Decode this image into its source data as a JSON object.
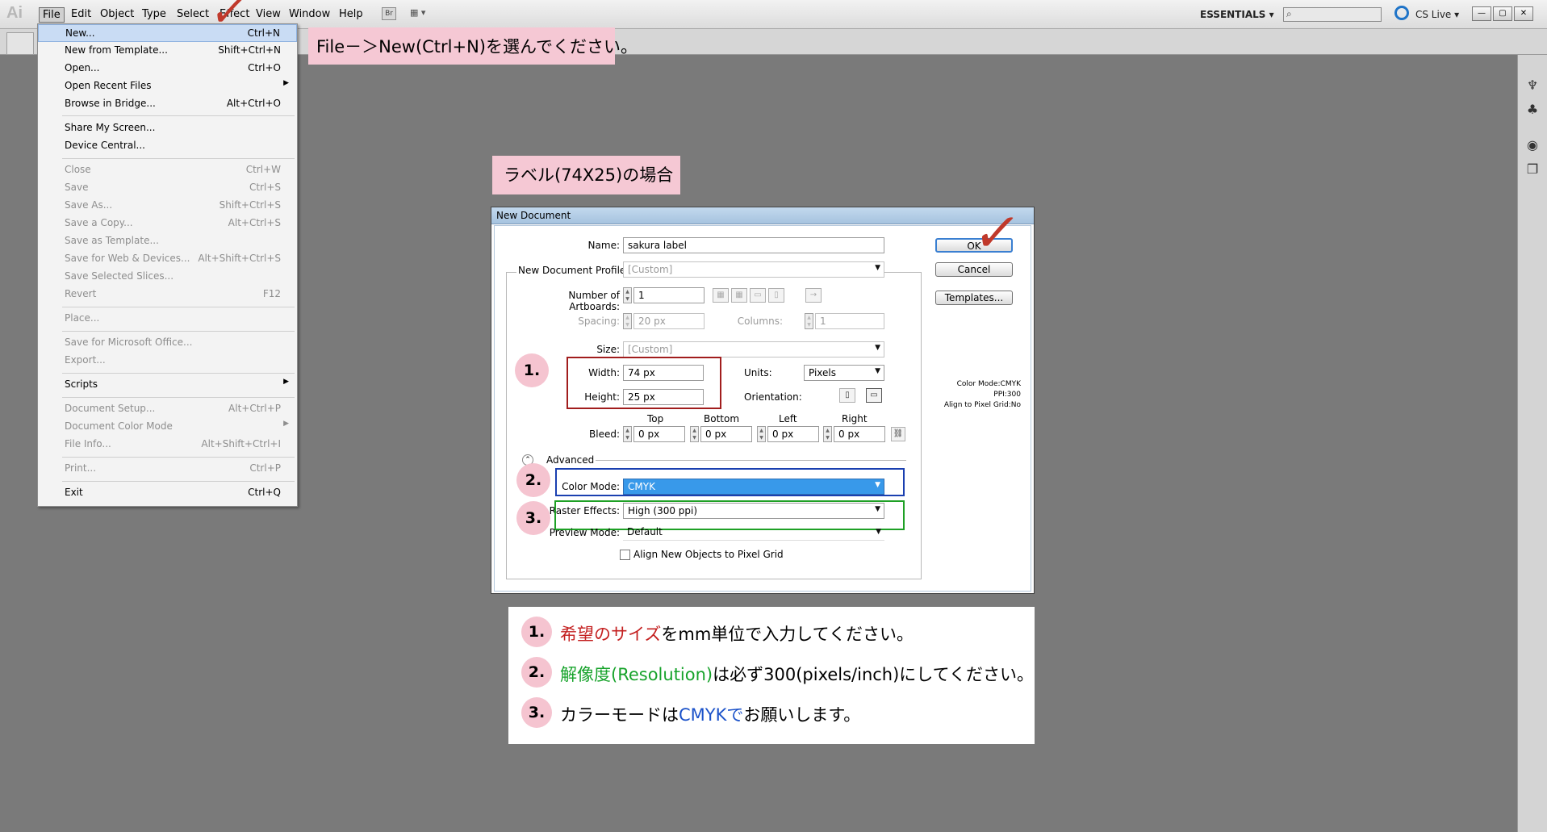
{
  "menubar": {
    "app_logo": "Ai",
    "menus": [
      "File",
      "Edit",
      "Object",
      "Type",
      "Select",
      "Effect",
      "View",
      "Window",
      "Help"
    ],
    "bridge_label": "Br",
    "workspace": "ESSENTIALS",
    "cs_live": "CS Live",
    "window_buttons": [
      "—",
      "▢",
      "✕"
    ]
  },
  "file_menu": {
    "items": [
      {
        "label": "New...",
        "shortcut": "Ctrl+N"
      },
      {
        "label": "New from Template...",
        "shortcut": "Shift+Ctrl+N"
      },
      {
        "label": "Open...",
        "shortcut": "Ctrl+O"
      },
      {
        "label": "Open Recent Files",
        "shortcut": ""
      },
      {
        "label": "Browse in Bridge...",
        "shortcut": "Alt+Ctrl+O"
      },
      {
        "label": "Share My Screen...",
        "shortcut": ""
      },
      {
        "label": "Device Central...",
        "shortcut": ""
      },
      {
        "label": "Close",
        "shortcut": "Ctrl+W"
      },
      {
        "label": "Save",
        "shortcut": "Ctrl+S"
      },
      {
        "label": "Save As...",
        "shortcut": "Shift+Ctrl+S"
      },
      {
        "label": "Save a Copy...",
        "shortcut": "Alt+Ctrl+S"
      },
      {
        "label": "Save as Template...",
        "shortcut": ""
      },
      {
        "label": "Save for Web & Devices...",
        "shortcut": "Alt+Shift+Ctrl+S"
      },
      {
        "label": "Save Selected Slices...",
        "shortcut": ""
      },
      {
        "label": "Revert",
        "shortcut": "F12"
      },
      {
        "label": "Place...",
        "shortcut": ""
      },
      {
        "label": "Save for Microsoft Office...",
        "shortcut": ""
      },
      {
        "label": "Export...",
        "shortcut": ""
      },
      {
        "label": "Scripts",
        "shortcut": ""
      },
      {
        "label": "Document Setup...",
        "shortcut": "Alt+Ctrl+P"
      },
      {
        "label": "Document Color Mode",
        "shortcut": ""
      },
      {
        "label": "File Info...",
        "shortcut": "Alt+Shift+Ctrl+I"
      },
      {
        "label": "Print...",
        "shortcut": "Ctrl+P"
      },
      {
        "label": "Exit",
        "shortcut": "Ctrl+Q"
      }
    ]
  },
  "callouts": {
    "new_instruction": "File－＞New(Ctrl+N)を選んでください。",
    "label_case": "ラベル(74X25)の場合"
  },
  "dialog": {
    "title": "New Document",
    "name_label": "Name:",
    "name_value": "sakura label",
    "profile_label": "New Document Profile:",
    "profile_value": "[Custom]",
    "artboards_label": "Number of Artboards:",
    "artboards_value": "1",
    "spacing_label": "Spacing:",
    "spacing_value": "20 px",
    "columns_label": "Columns:",
    "columns_value": "1",
    "size_label": "Size:",
    "size_value": "[Custom]",
    "width_label": "Width:",
    "width_value": "74 px",
    "height_label": "Height:",
    "height_value": "25 px",
    "units_label": "Units:",
    "units_value": "Pixels",
    "orientation_label": "Orientation:",
    "bleed_label": "Bleed:",
    "bleed_top_label": "Top",
    "bleed_bottom_label": "Bottom",
    "bleed_left_label": "Left",
    "bleed_right_label": "Right",
    "bleed_top": "0 px",
    "bleed_bottom": "0 px",
    "bleed_left": "0 px",
    "bleed_right": "0 px",
    "advanced_label": "Advanced",
    "color_mode_label": "Color Mode:",
    "color_mode_value": "CMYK",
    "raster_label": "Raster Effects:",
    "raster_value": "High (300 ppi)",
    "preview_label": "Preview Mode:",
    "preview_value": "Default",
    "align_label": "Align New Objects to Pixel Grid",
    "ok_label": "OK",
    "cancel_label": "Cancel",
    "templates_label": "Templates...",
    "info_color": "Color Mode:CMYK",
    "info_ppi": "PPI:300",
    "info_align": "Align to Pixel Grid:No"
  },
  "markers": [
    "1.",
    "2.",
    "3."
  ],
  "notes": {
    "n1_num": "1.",
    "n1_red": "希望のサイズ",
    "n1_rest": "をmm単位で入力してください。",
    "n2_num": "2.",
    "n2_green": "解像度(Resolution)",
    "n2_rest": "は必ず300(pixels/inch)にしてください。",
    "n3_num": "3.",
    "n3_pre": "カラーモードは",
    "n3_blue": "CMYKで",
    "n3_rest": "お願いします。"
  },
  "colors": {
    "highlight_size": "#a11d1d",
    "highlight_color_mode": "#1a3fb0",
    "highlight_raster": "#1ea025",
    "callout_bg": "#f5c8d4",
    "selection": "#3899ea"
  }
}
